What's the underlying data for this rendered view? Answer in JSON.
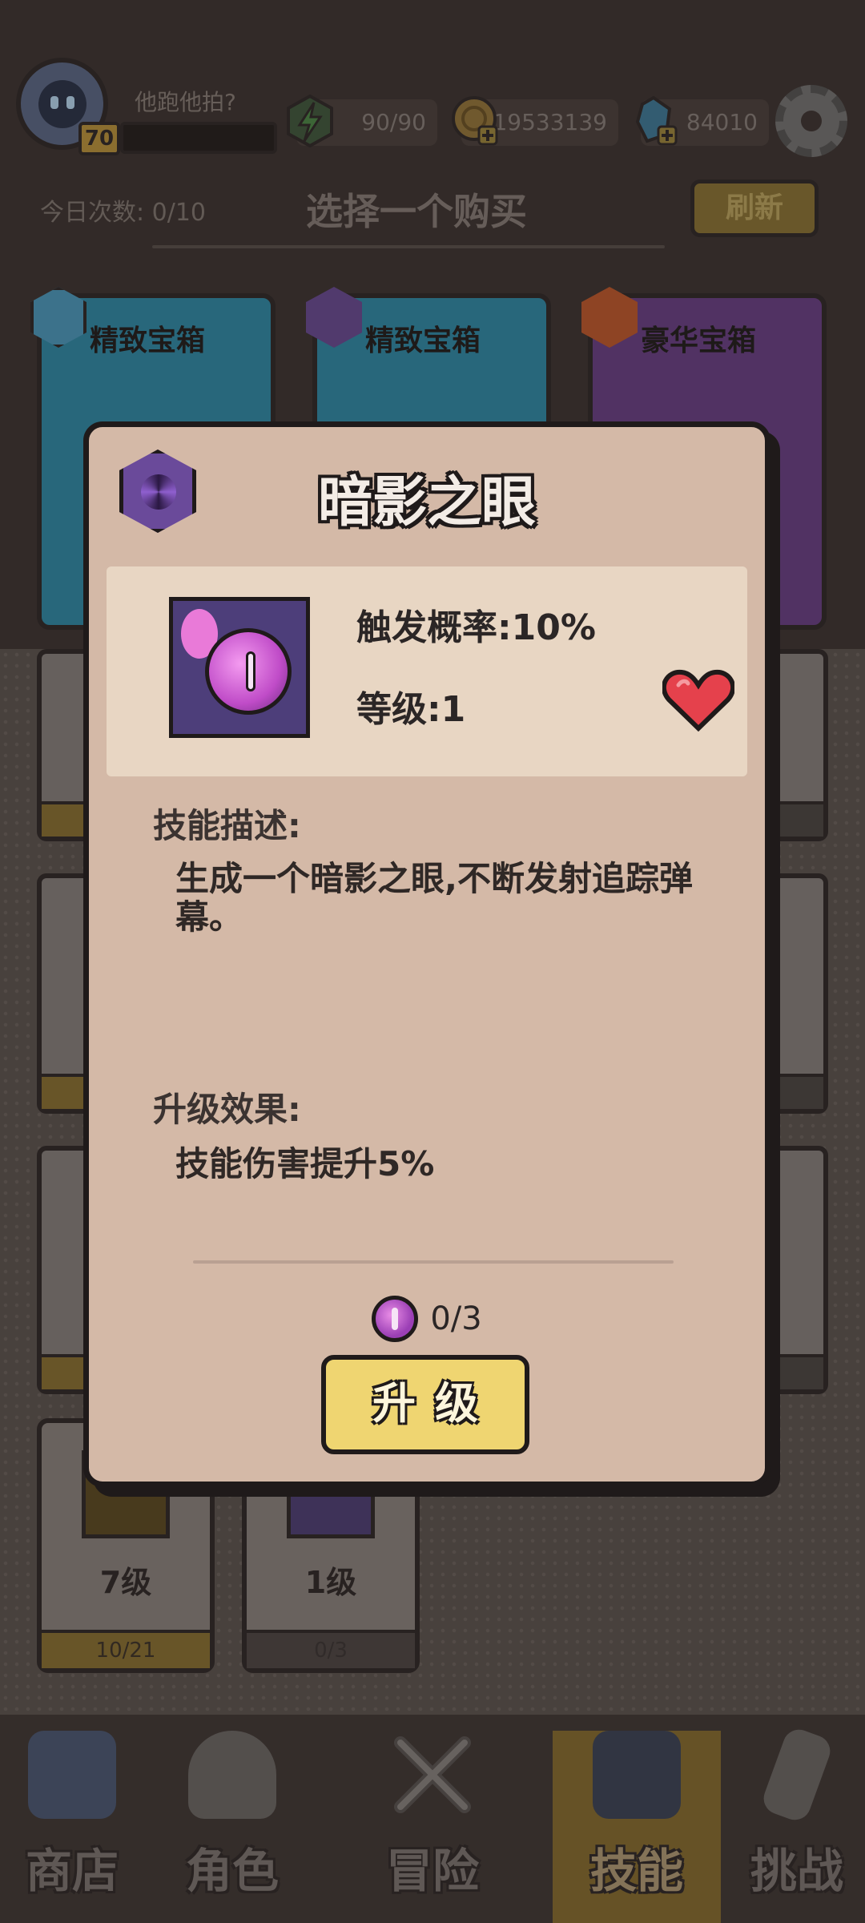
{
  "player": {
    "name": "他跑他拍?",
    "level": "70"
  },
  "resources": {
    "energy": "90/90",
    "coins": "19533139",
    "gems": "84010"
  },
  "shop": {
    "daily_count": "今日次数: 0/10",
    "title": "选择一个购买",
    "refresh_label": "刷新",
    "chests": [
      {
        "label": "精致宝箱"
      },
      {
        "label": "精致宝箱"
      },
      {
        "label": "豪华宝箱"
      }
    ]
  },
  "owned_skills": [
    {
      "level": "7级",
      "count": "10/21"
    },
    {
      "level": "1级",
      "count": "0/3"
    }
  ],
  "modal": {
    "title": "暗影之眼",
    "trigger_chance": "触发概率:10%",
    "level": "等级:1",
    "desc_label": "技能描述:",
    "desc": "生成一个暗影之眼,不断发射追踪弹幕。",
    "upgrade_effect_label": "升级效果:",
    "upgrade_effect": "技能伤害提升5%",
    "cost": "0/3",
    "upgrade_button": "升级"
  },
  "nav": [
    {
      "label": "商店"
    },
    {
      "label": "角色"
    },
    {
      "label": "冒险"
    },
    {
      "label": "技能"
    },
    {
      "label": "挑战"
    }
  ],
  "colors": {
    "accent_yellow": "#efd571",
    "panel": "#d4b9a7",
    "shadow_purple": "#6a4a9a"
  }
}
